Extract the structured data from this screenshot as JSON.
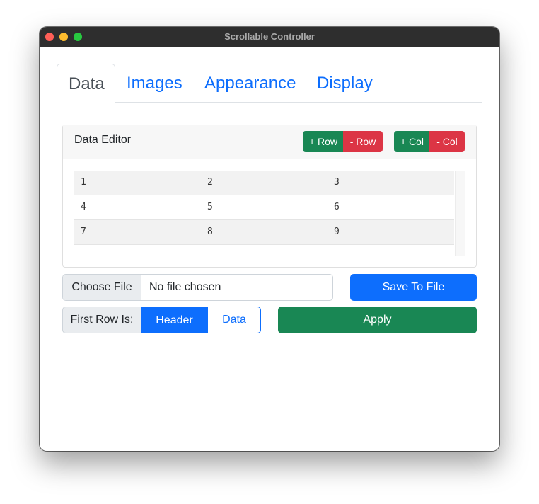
{
  "window": {
    "title": "Scrollable Controller"
  },
  "tabs": [
    {
      "label": "Data",
      "active": true
    },
    {
      "label": "Images",
      "active": false
    },
    {
      "label": "Appearance",
      "active": false
    },
    {
      "label": "Display",
      "active": false
    }
  ],
  "editor": {
    "title": "Data Editor",
    "add_row": "+ Row",
    "remove_row": "- Row",
    "add_col": "+ Col",
    "remove_col": "- Col",
    "rows": [
      [
        "1",
        "2",
        "3"
      ],
      [
        "4",
        "5",
        "6"
      ],
      [
        "7",
        "8",
        "9"
      ]
    ]
  },
  "file": {
    "choose_label": "Choose File",
    "status": "No file chosen",
    "save_label": "Save To File"
  },
  "first_row": {
    "label": "First Row Is:",
    "options": [
      "Header",
      "Data"
    ],
    "selected": "Header"
  },
  "apply_label": "Apply",
  "colors": {
    "primary": "#0d6efd",
    "success": "#198754",
    "danger": "#dc3545"
  }
}
